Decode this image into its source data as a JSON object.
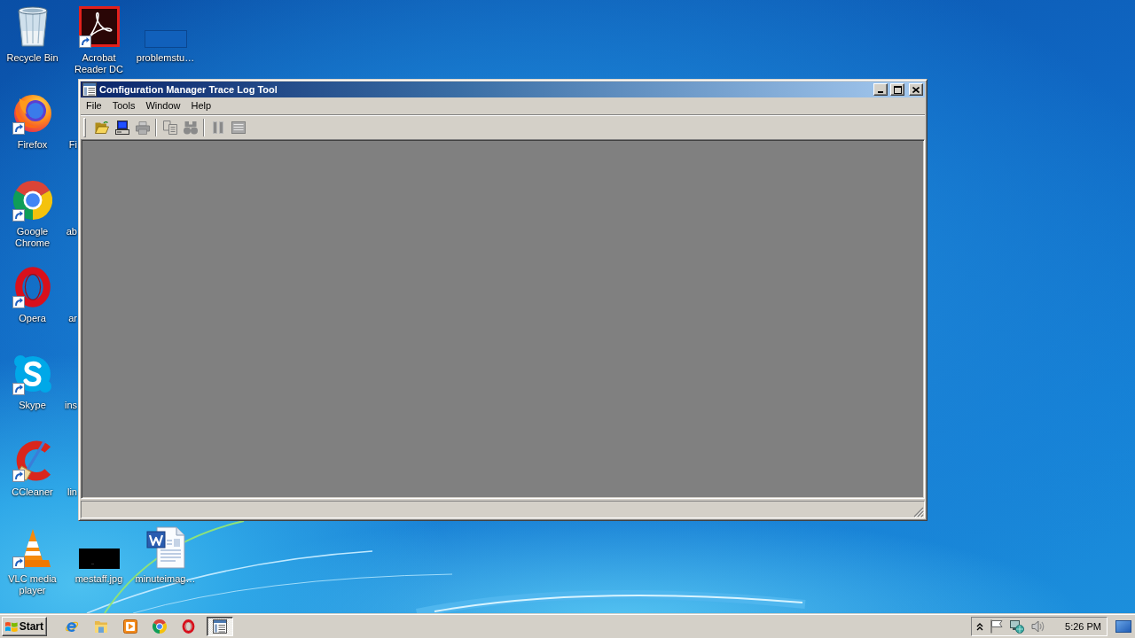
{
  "desktop": {
    "icons": [
      {
        "kind": "recycle-bin",
        "label": "Recycle Bin",
        "shortcut": false
      },
      {
        "kind": "firefox",
        "label": "Firefox",
        "shortcut": true
      },
      {
        "kind": "chrome",
        "label": "Google Chrome",
        "shortcut": true
      },
      {
        "kind": "opera",
        "label": "Opera",
        "shortcut": true
      },
      {
        "kind": "skype",
        "label": "Skype",
        "shortcut": true
      },
      {
        "kind": "ccleaner",
        "label": "CCleaner",
        "shortcut": true
      },
      {
        "kind": "vlc",
        "label": "VLC media player",
        "shortcut": true
      },
      {
        "kind": "acrobat",
        "label": "Acrobat Reader DC",
        "shortcut": true
      },
      {
        "kind": "covered",
        "label": "Fi"
      },
      {
        "kind": "covered",
        "label": "ab"
      },
      {
        "kind": "covered",
        "label": "ar"
      },
      {
        "kind": "covered",
        "label": "ins"
      },
      {
        "kind": "covered",
        "label": "lin"
      },
      {
        "kind": "image-thumbnail",
        "label": "mestaff.jpg",
        "shortcut": false
      },
      {
        "kind": "blank-file",
        "label": "problemstu…",
        "shortcut": false
      },
      {
        "kind": "word-document",
        "label": "minuteimag…",
        "shortcut": false
      }
    ]
  },
  "window": {
    "title": "Configuration Manager Trace Log Tool",
    "menu": [
      "File",
      "Tools",
      "Window",
      "Help"
    ],
    "toolbar": [
      {
        "kind": "open",
        "disabled": false
      },
      {
        "kind": "computer",
        "disabled": false
      },
      {
        "kind": "print",
        "disabled": true
      },
      {
        "kind": "separator"
      },
      {
        "kind": "copy",
        "disabled": true
      },
      {
        "kind": "find",
        "disabled": true
      },
      {
        "kind": "separator"
      },
      {
        "kind": "pause",
        "disabled": true
      },
      {
        "kind": "list",
        "disabled": true
      }
    ]
  },
  "taskbar": {
    "start": "Start",
    "quick_launch": [
      {
        "kind": "ie"
      },
      {
        "kind": "explorer"
      },
      {
        "kind": "media-player"
      },
      {
        "kind": "chrome"
      },
      {
        "kind": "opera"
      }
    ],
    "tasks": [
      {
        "kind": "trace-log",
        "selected": true
      }
    ],
    "tray": {
      "clock": "5:26 PM"
    }
  }
}
